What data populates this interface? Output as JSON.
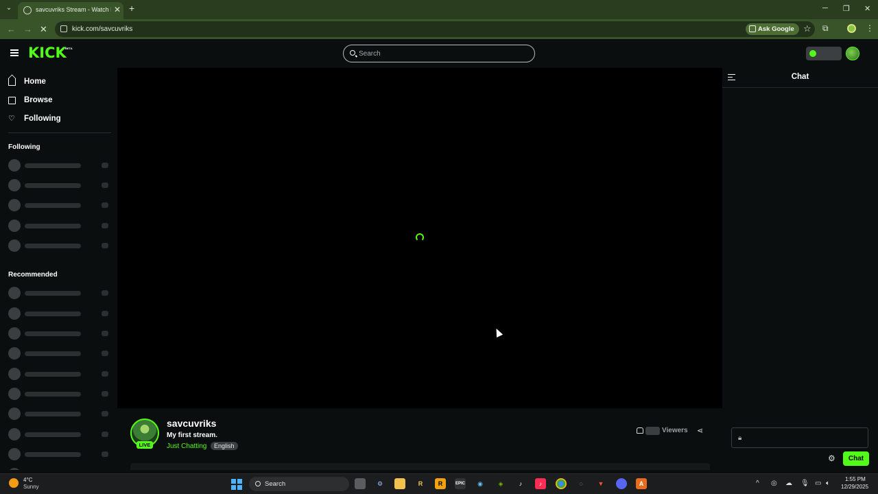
{
  "browser": {
    "tab_title": "savcuvriks Stream - Watch Live",
    "url": "kick.com/savcuvriks",
    "ask_google": "Ask Google"
  },
  "header": {
    "logo": "KICK",
    "logo_badge": "BETA",
    "search_placeholder": "Search"
  },
  "sidebar": {
    "nav": [
      {
        "label": "Home",
        "icon": "home-icon"
      },
      {
        "label": "Browse",
        "icon": "browse-icon"
      },
      {
        "label": "Following",
        "icon": "heart-icon"
      }
    ],
    "following_title": "Following",
    "recommended_title": "Recommended"
  },
  "stream": {
    "channel": "savcuvriks",
    "live_badge": "LIVE",
    "title": "My first stream.",
    "category": "Just Chatting",
    "language": "English",
    "viewers_label": "Viewers"
  },
  "chat": {
    "title": "Chat",
    "send_label": "Chat"
  },
  "taskbar": {
    "weather_temp": "4°C",
    "weather_cond": "Sunny",
    "search_label": "Search",
    "time": "1:55 PM",
    "date": "12/29/2025"
  },
  "colors": {
    "accent": "#53fc18",
    "background": "#0b0e0f",
    "browser_frame": "#3a5429"
  }
}
